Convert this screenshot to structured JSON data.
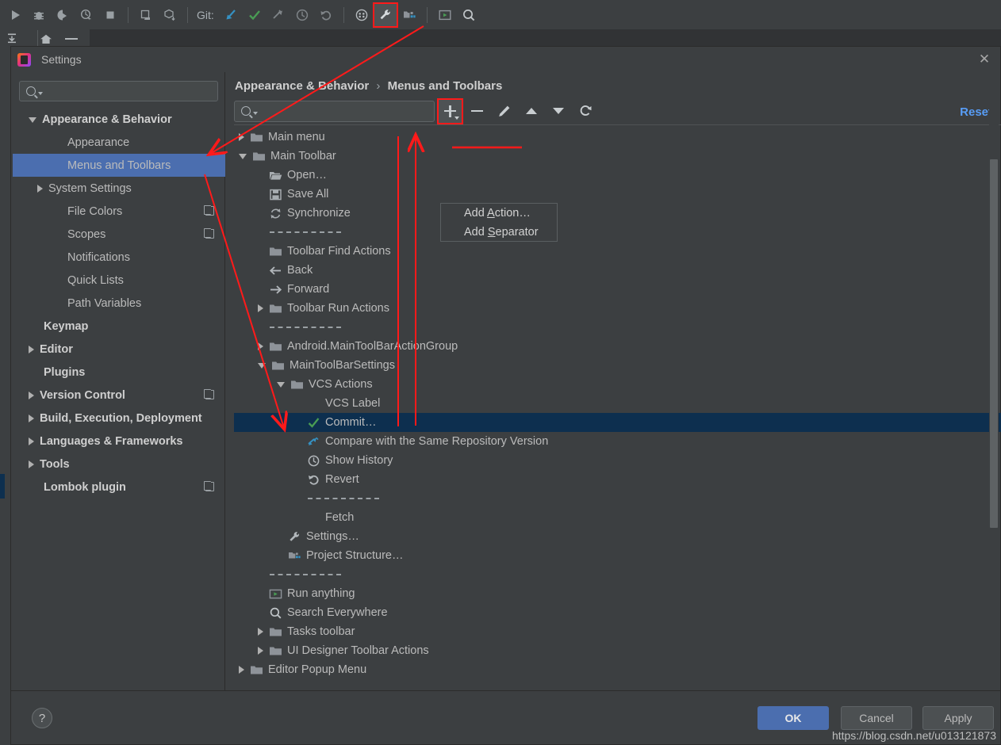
{
  "ide_toolbar": {
    "git_label": "Git:",
    "buttons": [
      {
        "name": "run-icon",
        "glyph": "▶"
      },
      {
        "name": "debug-icon",
        "glyph": "🐞"
      },
      {
        "name": "run-with-coverage-icon",
        "glyph": "◐"
      },
      {
        "name": "profile-icon",
        "glyph": "◔"
      },
      {
        "name": "stop-icon",
        "glyph": "■"
      },
      {
        "name": "sync-project-icon",
        "glyph": "⎘"
      },
      {
        "name": "build-icon",
        "glyph": "⬓"
      },
      {
        "name": "update-project-icon",
        "glyph": "↙"
      },
      {
        "name": "commit-icon",
        "glyph": "✓"
      },
      {
        "name": "push-icon",
        "glyph": "⇲"
      },
      {
        "name": "history-icon",
        "glyph": "◷"
      },
      {
        "name": "rollback-icon",
        "glyph": "↺"
      },
      {
        "name": "avd-manager-icon",
        "glyph": "⠿"
      },
      {
        "name": "settings-wrench-icon",
        "glyph": "🔧"
      },
      {
        "name": "project-structure-icon",
        "glyph": "▦"
      },
      {
        "name": "run-anything-icon",
        "glyph": "▣"
      },
      {
        "name": "search-everywhere-icon",
        "glyph": "🔍"
      }
    ]
  },
  "dialog": {
    "title": "Settings",
    "close_label": "✕",
    "reset_label": "Reset"
  },
  "sidebar": {
    "search_placeholder": "",
    "items": [
      {
        "label": "Appearance & Behavior",
        "indent": 0,
        "twisty": "down",
        "bold": true,
        "selected": false,
        "copy": false
      },
      {
        "label": "Appearance",
        "indent": 1,
        "twisty": "none",
        "bold": false,
        "selected": false,
        "copy": false
      },
      {
        "label": "Menus and Toolbars",
        "indent": 1,
        "twisty": "none",
        "bold": false,
        "selected": true,
        "copy": false
      },
      {
        "label": "System Settings",
        "indent": 1,
        "twisty": "right",
        "bold": false,
        "selected": false,
        "copy": false
      },
      {
        "label": "File Colors",
        "indent": 1,
        "twisty": "none",
        "bold": false,
        "selected": false,
        "copy": true
      },
      {
        "label": "Scopes",
        "indent": 1,
        "twisty": "none",
        "bold": false,
        "selected": false,
        "copy": true
      },
      {
        "label": "Notifications",
        "indent": 1,
        "twisty": "none",
        "bold": false,
        "selected": false,
        "copy": false
      },
      {
        "label": "Quick Lists",
        "indent": 1,
        "twisty": "none",
        "bold": false,
        "selected": false,
        "copy": false
      },
      {
        "label": "Path Variables",
        "indent": 1,
        "twisty": "none",
        "bold": false,
        "selected": false,
        "copy": false
      },
      {
        "label": "Keymap",
        "indent": 0,
        "twisty": "none",
        "bold": true,
        "selected": false,
        "copy": false
      },
      {
        "label": "Editor",
        "indent": 0,
        "twisty": "right",
        "bold": true,
        "selected": false,
        "copy": false
      },
      {
        "label": "Plugins",
        "indent": 0,
        "twisty": "none",
        "bold": true,
        "selected": false,
        "copy": false
      },
      {
        "label": "Version Control",
        "indent": 0,
        "twisty": "right",
        "bold": true,
        "selected": false,
        "copy": true
      },
      {
        "label": "Build, Execution, Deployment",
        "indent": 0,
        "twisty": "right",
        "bold": true,
        "selected": false,
        "copy": false
      },
      {
        "label": "Languages & Frameworks",
        "indent": 0,
        "twisty": "right",
        "bold": true,
        "selected": false,
        "copy": false
      },
      {
        "label": "Tools",
        "indent": 0,
        "twisty": "right",
        "bold": true,
        "selected": false,
        "copy": false
      },
      {
        "label": "Lombok plugin",
        "indent": 0,
        "twisty": "none",
        "bold": true,
        "selected": false,
        "copy": true
      }
    ]
  },
  "pane": {
    "breadcrumb_root": "Appearance & Behavior",
    "breadcrumb_sep": "›",
    "breadcrumb_leaf": "Menus and Toolbars",
    "search_placeholder": "",
    "toolbar_buttons": [
      {
        "name": "add-button",
        "label": "+",
        "active": true
      },
      {
        "name": "remove-button",
        "label": "−",
        "active": false
      },
      {
        "name": "edit-button",
        "label": "✎",
        "active": false
      },
      {
        "name": "move-up-button",
        "label": "▲",
        "active": false
      },
      {
        "name": "move-down-button",
        "label": "▼",
        "active": false
      },
      {
        "name": "restore-button",
        "label": "↺",
        "active": false
      }
    ],
    "dropdown": {
      "items": [
        {
          "label": "Add Action...",
          "mnemonic_index": 4,
          "underlined": true
        },
        {
          "label": "Add Separator",
          "mnemonic_index": 4,
          "underlined": false
        }
      ]
    }
  },
  "tree": {
    "rows": [
      {
        "label": "Main menu",
        "indent": 0,
        "twisty": "right",
        "icon": "folder",
        "selected": false
      },
      {
        "label": "Main Toolbar",
        "indent": 0,
        "twisty": "down",
        "icon": "folder",
        "selected": false
      },
      {
        "label": "Open…",
        "indent": 1,
        "twisty": "none",
        "icon": "open",
        "selected": false
      },
      {
        "label": "Save All",
        "indent": 1,
        "twisty": "none",
        "icon": "save",
        "selected": false
      },
      {
        "label": "Synchronize",
        "indent": 1,
        "twisty": "none",
        "icon": "sync",
        "selected": false
      },
      {
        "label": "",
        "indent": 1,
        "twisty": "none",
        "icon": "separator",
        "selected": false
      },
      {
        "label": "Toolbar Find Actions",
        "indent": 1,
        "twisty": "none",
        "icon": "folder",
        "selected": false
      },
      {
        "label": "Back",
        "indent": 1,
        "twisty": "none",
        "icon": "back",
        "selected": false
      },
      {
        "label": "Forward",
        "indent": 1,
        "twisty": "none",
        "icon": "forward",
        "selected": false
      },
      {
        "label": "Toolbar Run Actions",
        "indent": 1,
        "twisty": "right",
        "icon": "folder",
        "selected": false
      },
      {
        "label": "",
        "indent": 1,
        "twisty": "none",
        "icon": "separator",
        "selected": false
      },
      {
        "label": "Android.MainToolBarActionGroup",
        "indent": 1,
        "twisty": "right",
        "icon": "folder",
        "selected": false
      },
      {
        "label": "MainToolBarSettings",
        "indent": 1,
        "twisty": "down",
        "icon": "folder",
        "selected": false
      },
      {
        "label": "VCS Actions",
        "indent": 2,
        "twisty": "down",
        "icon": "folder",
        "selected": false
      },
      {
        "label": "VCS Label",
        "indent": 3,
        "twisty": "none",
        "icon": "none",
        "selected": false
      },
      {
        "label": "Commit…",
        "indent": 3,
        "twisty": "none",
        "icon": "check",
        "selected": true
      },
      {
        "label": "Compare with the Same Repository Version",
        "indent": 3,
        "twisty": "none",
        "icon": "compare",
        "selected": false
      },
      {
        "label": "Show History",
        "indent": 3,
        "twisty": "none",
        "icon": "clock",
        "selected": false
      },
      {
        "label": "Revert",
        "indent": 3,
        "twisty": "none",
        "icon": "revert",
        "selected": false
      },
      {
        "label": "",
        "indent": 3,
        "twisty": "none",
        "icon": "separator",
        "selected": false
      },
      {
        "label": "Fetch",
        "indent": 3,
        "twisty": "none",
        "icon": "none",
        "selected": false
      },
      {
        "label": "Settings…",
        "indent": 2,
        "twisty": "none",
        "icon": "wrench",
        "selected": false
      },
      {
        "label": "Project Structure…",
        "indent": 2,
        "twisty": "none",
        "icon": "projstruct",
        "selected": false
      },
      {
        "label": "",
        "indent": 1,
        "twisty": "none",
        "icon": "separator",
        "selected": false
      },
      {
        "label": "Run anything",
        "indent": 1,
        "twisty": "none",
        "icon": "runany",
        "selected": false
      },
      {
        "label": "Search Everywhere",
        "indent": 1,
        "twisty": "none",
        "icon": "search",
        "selected": false
      },
      {
        "label": "Tasks toolbar",
        "indent": 1,
        "twisty": "right",
        "icon": "folder",
        "selected": false
      },
      {
        "label": "UI Designer Toolbar Actions",
        "indent": 1,
        "twisty": "right",
        "icon": "folder",
        "selected": false
      },
      {
        "label": "Editor Popup Menu",
        "indent": 0,
        "twisty": "right",
        "icon": "folder",
        "selected": false
      }
    ]
  },
  "footer": {
    "help_label": "?",
    "ok_label": "OK",
    "cancel_label": "Cancel",
    "apply_label": "Apply"
  },
  "watermark": "https://blog.csdn.net/u013121873",
  "colors": {
    "bg": "#3c3f41",
    "selection_blue": "#4b6eaf",
    "tree_selection": "#0d2f4f",
    "accent_link": "#589df6",
    "annotation_red": "#ff1a1a",
    "green_check": "#4caf50",
    "blue_arrow": "#3592c4"
  }
}
